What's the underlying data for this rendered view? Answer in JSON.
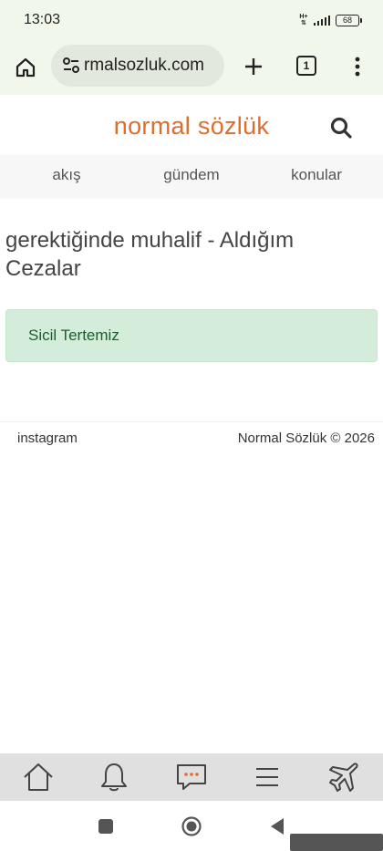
{
  "status_bar": {
    "time": "13:03",
    "network": "H+",
    "battery": "68"
  },
  "browser": {
    "url": "rmalsozluk.com",
    "tab_count": "1"
  },
  "site": {
    "logo": "normal sözlük",
    "nav": [
      {
        "label": "akış"
      },
      {
        "label": "gündem"
      },
      {
        "label": "konular"
      }
    ]
  },
  "main": {
    "title": "gerektiğinde muhalif - Aldığım Cezalar",
    "alert": "Sicil Tertemiz"
  },
  "footer": {
    "link": "instagram",
    "copyright": "Normal Sözlük © 2026"
  },
  "colors": {
    "logo": "#e06c2e",
    "alert_bg": "#d4edda",
    "alert_text": "#1e5c2e",
    "chat_dots": "#e06c2e",
    "browser_chrome": "#f2f7ec"
  },
  "icons": {
    "bottom_bar": [
      "home-icon",
      "bell-icon",
      "chat-icon",
      "menu-icon",
      "plane-icon"
    ],
    "android_nav": [
      "recents-icon",
      "home-circle-icon",
      "back-icon"
    ]
  }
}
